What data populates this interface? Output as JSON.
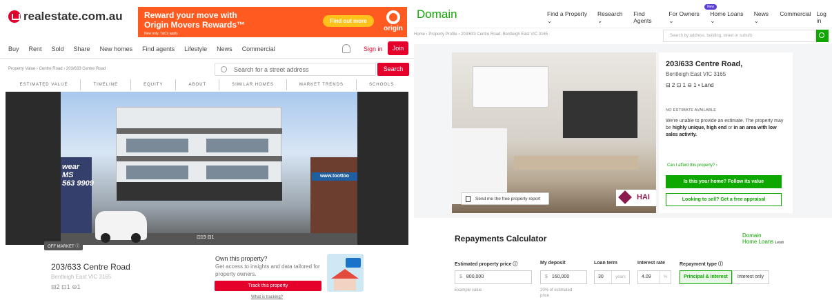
{
  "rea": {
    "logo": "realestate.com.au",
    "ad": {
      "title": "Reward your move with Origin Movers Rewards™",
      "small": "New only. T&Cs apply",
      "button": "Find out more",
      "brand": "origin"
    },
    "nav": [
      "Buy",
      "Rent",
      "Sold",
      "Share",
      "New homes",
      "Find agents",
      "Lifestyle",
      "News",
      "Commercial"
    ],
    "signin": "Sign in",
    "join": "Join",
    "breadcrumb": "Property Value  ›  Centre Road  ›  203/633 Centre Road",
    "search_placeholder": "Search for a street address",
    "search_button": "Search",
    "subnav": [
      "ESTIMATED VALUE",
      "TIMELINE",
      "EQUITY",
      "ABOUT",
      "SIMILAR HOMES",
      "MARKET TRENDS",
      "SCHOOLS"
    ],
    "shop_left_sign": "wear\nMS\n563 9909",
    "shop_right_sign": "www.toottoo",
    "off_market": "OFF MARKET ⓘ",
    "photo_count": "⊡19  ⊟1",
    "address": "203/633 Centre Road",
    "suburb": "Bentleigh East VIC 3165",
    "features": "⊟2  ⊡1  ⊖1",
    "own_title": "Own this property?",
    "own_text": "Get access to insights and data tailored for property owners.",
    "track_button": "Track this property",
    "what_link": "What is tracking?"
  },
  "domain": {
    "logo": "Domain",
    "nav": [
      "Find a Property ⌄",
      "Research ⌄",
      "Find Agents",
      "For Owners ⌄",
      "Home Loans ⌄",
      "News ⌄",
      "Commercial",
      "Log in"
    ],
    "new_badge": "New",
    "breadcrumb": "Home  ›  Property Profile  ›  203/633 Centre Road, Bentleigh East VIC 3165",
    "search_placeholder": "Search by address, building, street or suburb",
    "send_report": "Send me the free property report",
    "agency": "HAI",
    "address": "203/633 Centre Road,",
    "suburb": "Bentleigh East VIC 3165",
    "features": "⊟ 2  ⊡ 1  ⊖ 1 • Land",
    "no_estimate": "NO ESTIMATE AVAILABLE",
    "no_estimate_text_1": "We're unable to provide an estimate. The property may be ",
    "no_estimate_bold_1": "highly unique, high end",
    "no_estimate_text_2": " or ",
    "no_estimate_bold_2": "in an area with low sales activity.",
    "afford_link": "Can I afford this property? ›",
    "follow_button": "Is this your home? Follow its value",
    "appraisal_button": "Looking to sell? Get a free appraisal",
    "calc": {
      "title": "Repayments Calculator",
      "partner": "Domain\nHome Loans",
      "partner_small": "Lendi",
      "price_label": "Estimated property price ⓘ",
      "price_prefix": "$",
      "price_value": "800,000",
      "deposit_label": "My deposit",
      "deposit_prefix": "$",
      "deposit_value": "160,000",
      "term_label": "Loan term",
      "term_value": "30",
      "term_suffix": "years",
      "rate_label": "Interest rate",
      "rate_value": "4.09",
      "rate_suffix": "%",
      "type_label": "Repayment type ⓘ",
      "pi_button": "Principal & interest",
      "io_button": "Interest only",
      "example_note": "Example value",
      "deposit_note": "20% of estimated\nprice"
    }
  },
  "colors": {
    "rea_red": "#e4002b",
    "domain_green": "#0ea800",
    "origin_orange": "#ff5a1f"
  }
}
